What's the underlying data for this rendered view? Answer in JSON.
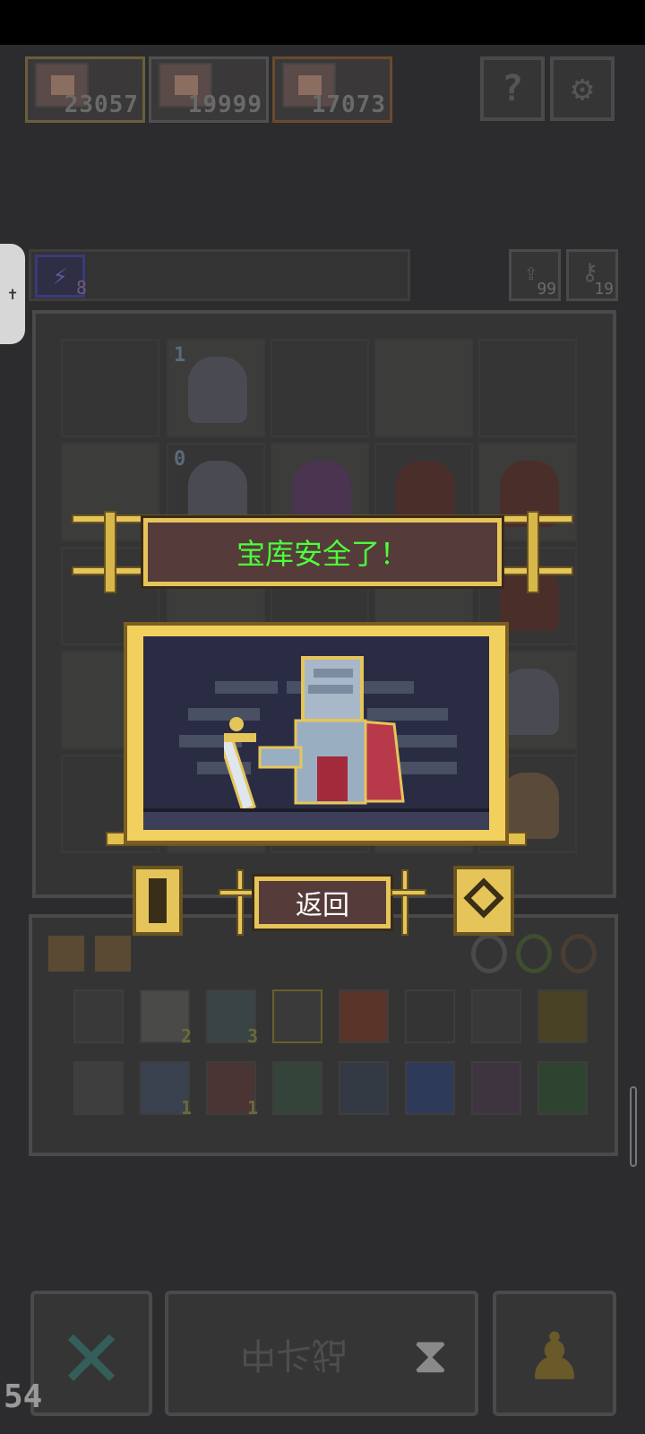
{
  "heroes": [
    {
      "score": "23057",
      "frame_color": "#6a5e3a"
    },
    {
      "score": "19999",
      "frame_color": "#505050"
    },
    {
      "score": "17073",
      "frame_color": "#6a4a2e"
    }
  ],
  "top_buttons": {
    "help_glyph": "?",
    "settings_glyph": "⚙"
  },
  "energy": {
    "count": "8"
  },
  "resources": [
    {
      "name": "refresh",
      "glyph": "⇪",
      "count": "99"
    },
    {
      "name": "key",
      "glyph": "⚷",
      "count": "19"
    }
  ],
  "board": {
    "level_badges": [
      "1",
      "0"
    ]
  },
  "modal": {
    "title": "宝库安全了！",
    "return_label": "返回"
  },
  "inventory": {
    "row1": [
      {
        "name": "gear-item",
        "qty": ""
      },
      {
        "name": "scroll-item",
        "qty": "2"
      },
      {
        "name": "heart-item",
        "qty": "3"
      },
      {
        "name": "crown-item",
        "qty": ""
      },
      {
        "name": "fire-item",
        "qty": ""
      },
      {
        "name": "arrow-item",
        "qty": ""
      },
      {
        "name": "shuriken-item",
        "qty": ""
      },
      {
        "name": "trophy-item",
        "qty": ""
      }
    ],
    "row2": [
      {
        "name": "lever-item",
        "qty": ""
      },
      {
        "name": "hammer-item",
        "qty": "1"
      },
      {
        "name": "anchor-item",
        "qty": "1"
      },
      {
        "name": "grass-item",
        "qty": ""
      },
      {
        "name": "water-drop-item",
        "qty": ""
      },
      {
        "name": "blue-orb-item",
        "qty": ""
      },
      {
        "name": "purple-arrow-item",
        "qty": ""
      },
      {
        "name": "green-box-item",
        "qty": ""
      }
    ]
  },
  "bottom": {
    "cancel_glyph": "✕",
    "battle_label": "战斗中",
    "hourglass_glyph": "⧗",
    "pawn_glyph": "♟"
  },
  "fps": "54",
  "accessibility_glyph": "✝"
}
